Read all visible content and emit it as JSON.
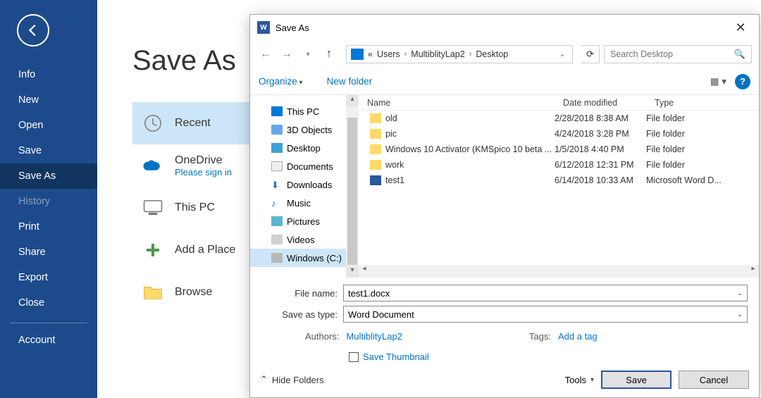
{
  "backstage": {
    "pageTitle": "Save As",
    "items": [
      "Info",
      "New",
      "Open",
      "Save",
      "Save As",
      "History",
      "Print",
      "Share",
      "Export",
      "Close"
    ],
    "bottom": "Account"
  },
  "locations": {
    "recent": "Recent",
    "onedrive": "OneDrive",
    "onedriveSub": "Please sign in",
    "thispc": "This PC",
    "addplace": "Add a Place",
    "browse": "Browse"
  },
  "dialog": {
    "title": "Save As",
    "breadcrumbs": [
      "Users",
      "MultiblityLap2",
      "Desktop"
    ],
    "searchPlaceholder": "Search Desktop",
    "organize": "Organize",
    "newFolder": "New folder",
    "tree": [
      "This PC",
      "3D Objects",
      "Desktop",
      "Documents",
      "Downloads",
      "Music",
      "Pictures",
      "Videos",
      "Windows (C:)"
    ],
    "cols": {
      "name": "Name",
      "date": "Date modified",
      "type": "Type"
    },
    "rows": [
      {
        "kind": "folder",
        "name": "old",
        "date": "2/28/2018 8:38 AM",
        "type": "File folder"
      },
      {
        "kind": "folder",
        "name": "pic",
        "date": "4/24/2018 3:28 PM",
        "type": "File folder"
      },
      {
        "kind": "folder",
        "name": "Windows 10 Activator (KMSpico 10 beta ...",
        "date": "1/5/2018 4:40 PM",
        "type": "File folder"
      },
      {
        "kind": "folder",
        "name": "work",
        "date": "6/12/2018 12:31 PM",
        "type": "File folder"
      },
      {
        "kind": "word",
        "name": "test1",
        "date": "6/14/2018 10:33 AM",
        "type": "Microsoft Word D..."
      }
    ],
    "fileNameLabel": "File name:",
    "saveTypeLabel": "Save as type:",
    "fileName": "test1.docx",
    "saveType": "Word Document",
    "authorsLabel": "Authors:",
    "authors": "MultiblityLap2",
    "tagsLabel": "Tags:",
    "tagsHint": "Add a tag",
    "saveThumbnail": "Save Thumbnail",
    "hideFolders": "Hide Folders",
    "tools": "Tools",
    "save": "Save",
    "cancel": "Cancel"
  }
}
